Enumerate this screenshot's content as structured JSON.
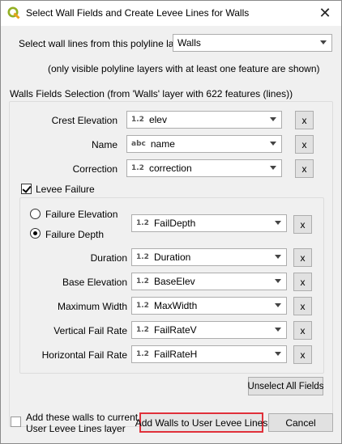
{
  "window": {
    "title": "Select Wall Fields and Create Levee Lines for Walls",
    "close_symbol": "✕"
  },
  "layer_select": {
    "label": "Select wall lines from this polyline layer",
    "value": "Walls",
    "note": "(only visible polyline layers with at least one feature are shown)"
  },
  "walls_fields": {
    "title": "Walls Fields Selection (from 'Walls' layer with 622 features (lines))",
    "rows": [
      {
        "label": "Crest Elevation",
        "type": "1.2",
        "value": "elev",
        "clear": "x"
      },
      {
        "label": "Name",
        "type": "abc",
        "value": "name",
        "clear": "x"
      },
      {
        "label": "Correction",
        "type": "1.2",
        "value": "correction",
        "clear": "x"
      }
    ]
  },
  "levee_failure": {
    "label": "Levee Failure",
    "checked": true,
    "radio_elevation": "Failure Elevation",
    "radio_depth": "Failure Depth",
    "selected_radio": "Failure Depth",
    "depth_field": {
      "type": "1.2",
      "value": "FailDepth",
      "clear": "x"
    },
    "rows": [
      {
        "label": "Duration",
        "type": "1.2",
        "value": "Duration",
        "clear": "x"
      },
      {
        "label": "Base Elevation",
        "type": "1.2",
        "value": "BaseElev",
        "clear": "x"
      },
      {
        "label": "Maximum Width",
        "type": "1.2",
        "value": "MaxWidth",
        "clear": "x"
      },
      {
        "label": "Vertical Fail Rate",
        "type": "1.2",
        "value": "FailRateV",
        "clear": "x"
      },
      {
        "label": "Horizontal Fail Rate",
        "type": "1.2",
        "value": "FailRateH",
        "clear": "x"
      }
    ]
  },
  "buttons": {
    "unselect_all": "Unselect All Fields",
    "add_walls": "Add Walls to User Levee Lines",
    "cancel": "Cancel"
  },
  "add_to_layer": {
    "line1": "Add these walls to current",
    "line2": "User Levee Lines layer",
    "checked": false
  },
  "colors": {
    "highlight": "#e0303a",
    "qgis_green": "#93b023"
  }
}
